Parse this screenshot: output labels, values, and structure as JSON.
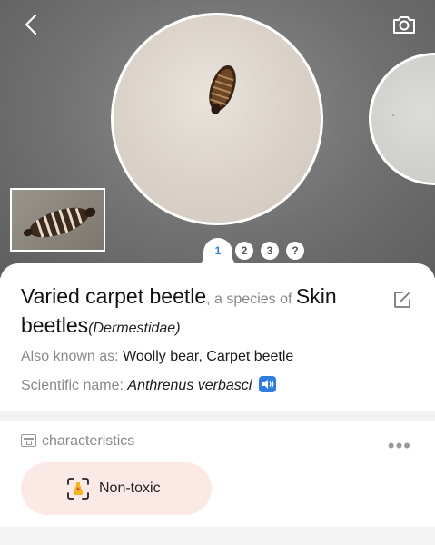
{
  "header": {
    "back_icon": "chevron-left-icon",
    "camera_icon": "camera-icon"
  },
  "gallery": {
    "pages": [
      "1",
      "2",
      "3",
      "?"
    ],
    "active_page": 1
  },
  "species": {
    "common_name": "Varied carpet beetle",
    "connector": ", a species of ",
    "group_name": "Skin beetles",
    "family": "(Dermestidae)",
    "also_known_label": "Also known as: ",
    "also_known_value": "Woolly bear, Carpet beetle",
    "scientific_label": "Scientific name: ",
    "scientific_value": "Anthrenus verbasci"
  },
  "characteristics": {
    "heading": "characteristics",
    "chip_label": "Non-toxic"
  },
  "colors": {
    "accent": "#2f7de1",
    "chip_bg": "#fbe9e6"
  }
}
